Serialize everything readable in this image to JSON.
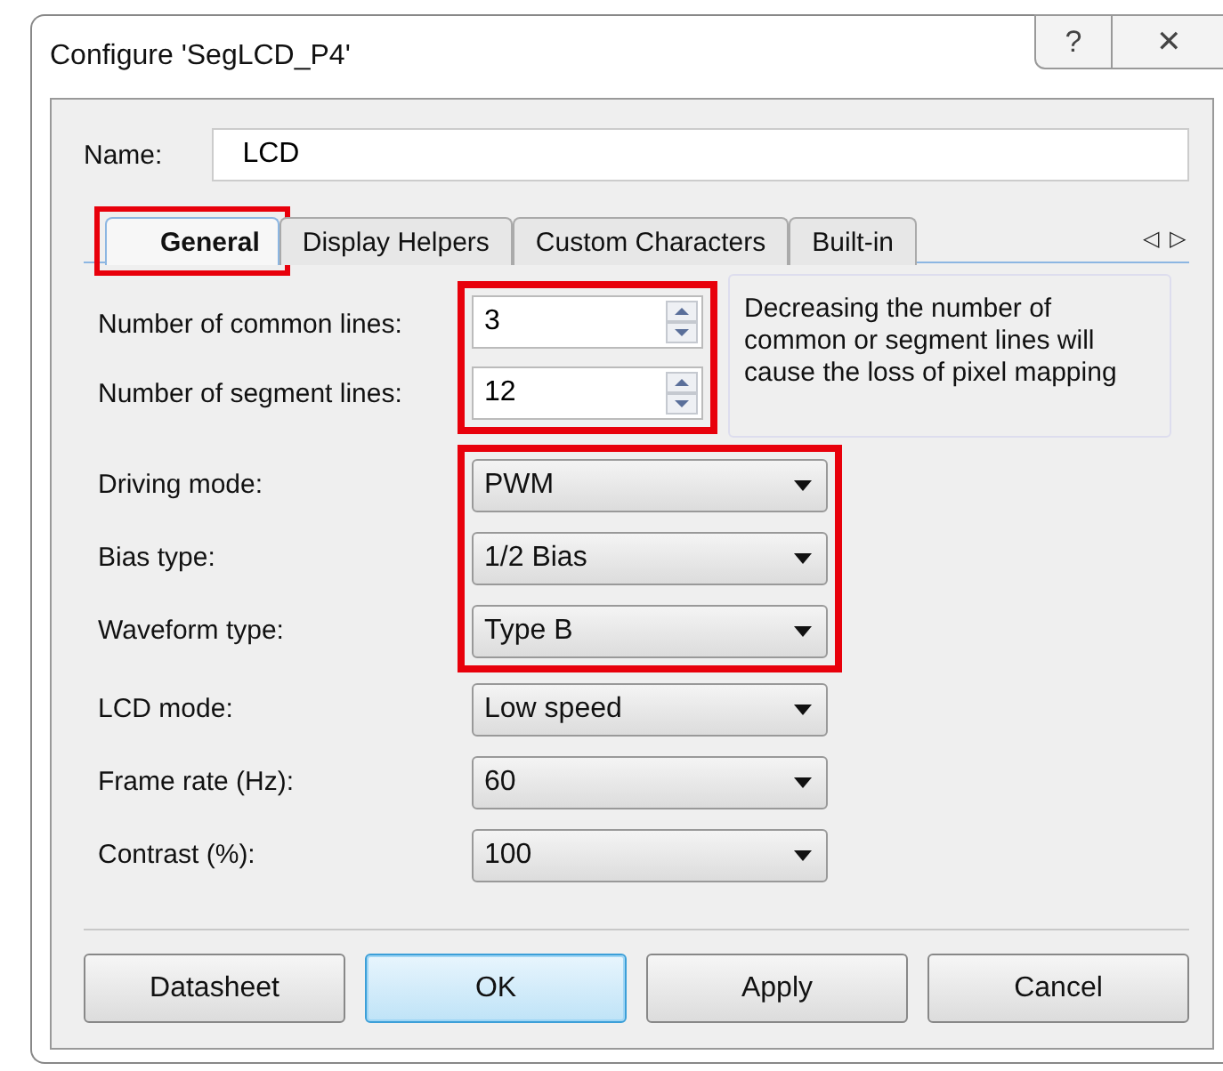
{
  "window": {
    "title": "Configure 'SegLCD_P4'",
    "help_button": "?",
    "close_button": "✕"
  },
  "name_field": {
    "label": "Name:",
    "value": "LCD"
  },
  "tabs": [
    {
      "label": "General",
      "selected": true,
      "highlighted": true
    },
    {
      "label": "Display Helpers",
      "selected": false,
      "highlighted": false
    },
    {
      "label": "Custom Characters",
      "selected": false,
      "highlighted": false
    },
    {
      "label": "Built-in",
      "selected": false,
      "highlighted": false
    }
  ],
  "tab_scroll": [
    "◁",
    "▷"
  ],
  "spinners": {
    "highlighted": true,
    "items": [
      {
        "label": "Number of common lines:",
        "value": "3"
      },
      {
        "label": "Number of segment lines:",
        "value": "12"
      }
    ]
  },
  "info_note": "Decreasing the number of common or segment lines will cause the loss of pixel mapping",
  "dropdown_groups": [
    {
      "highlighted": true,
      "items": [
        {
          "label": "Driving mode:",
          "value": "PWM"
        },
        {
          "label": "Bias type:",
          "value": "1/2 Bias"
        },
        {
          "label": "Waveform type:",
          "value": "Type B"
        }
      ]
    },
    {
      "highlighted": false,
      "items": [
        {
          "label": "LCD mode:",
          "value": "Low speed"
        },
        {
          "label": "Frame rate (Hz):",
          "value": "60"
        },
        {
          "label": "Contrast (%):",
          "value": "100"
        }
      ]
    }
  ],
  "buttons": [
    {
      "label": "Datasheet",
      "default": false
    },
    {
      "label": "OK",
      "default": true
    },
    {
      "label": "Apply",
      "default": false
    },
    {
      "label": "Cancel",
      "default": false
    }
  ]
}
